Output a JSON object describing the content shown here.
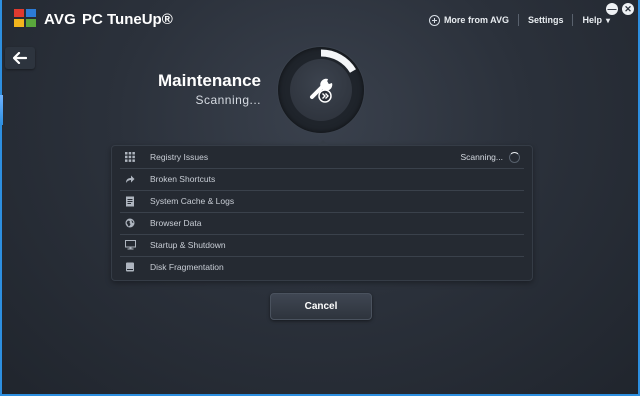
{
  "app": {
    "brand": "AVG",
    "product": "PC TuneUp®"
  },
  "topnav": {
    "more_from_avg": "More from AVG",
    "settings": "Settings",
    "help": "Help",
    "help_caret": "▾"
  },
  "window": {
    "minimize": "—",
    "close": "✕"
  },
  "header": {
    "title": "Maintenance",
    "subtitle": "Scanning..."
  },
  "tasks": [
    {
      "label": "Registry Issues",
      "status": "Scanning...",
      "icon": "grid-icon"
    },
    {
      "label": "Broken Shortcuts",
      "status": "",
      "icon": "shortcut-arrow-icon"
    },
    {
      "label": "System Cache & Logs",
      "status": "",
      "icon": "document-icon"
    },
    {
      "label": "Browser Data",
      "status": "",
      "icon": "globe-icon"
    },
    {
      "label": "Startup & Shutdown",
      "status": "",
      "icon": "monitor-icon"
    },
    {
      "label": "Disk Fragmentation",
      "status": "",
      "icon": "disk-icon"
    }
  ],
  "cancel_label": "Cancel",
  "colors": {
    "accent_blue": "#2d8fe0",
    "background": "#2b313b",
    "panel": "#252a32",
    "logo_red": "#e03a2f",
    "logo_green": "#5aa73c",
    "logo_blue": "#2c7bd6",
    "logo_yellow": "#f2b51d"
  }
}
